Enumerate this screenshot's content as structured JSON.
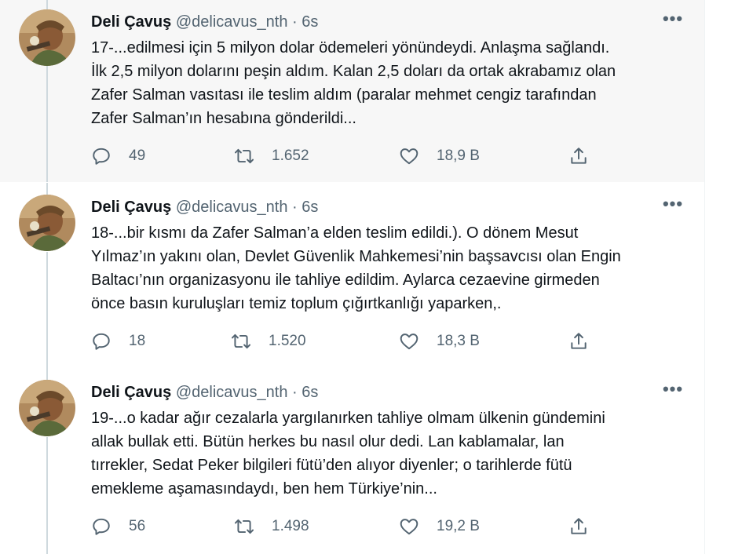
{
  "tweets": [
    {
      "name": "Deli Çavuş",
      "handle": "@delicavus_nth",
      "separator": "·",
      "time": "6s",
      "more": "•••",
      "lines": [
        "17-...edilmesi için 5 milyon dolar ödemeleri yönündeydi. Anlaşma sağlandı.",
        "İlk 2,5 milyon dolarını peşin aldım. Kalan 2,5 doları da ortak akrabamız olan",
        "Zafer Salman vasıtası ile teslim aldım (paralar mehmet cengiz tarafından",
        "Zafer Salman’ın hesabına gönderildi..."
      ],
      "replies": "49",
      "retweets": "1.652",
      "likes": "18,9 B"
    },
    {
      "name": "Deli Çavuş",
      "handle": "@delicavus_nth",
      "separator": "·",
      "time": "6s",
      "more": "•••",
      "lines": [
        "18-...bir kısmı da Zafer Salman’a elden teslim edildi.). O dönem Mesut",
        "Yılmaz’ın yakını olan, Devlet Güvenlik Mahkemesi’nin başsavcısı olan Engin",
        "Baltacı’nın organizasyonu ile tahliye edildim. Aylarca cezaevine girmeden",
        "önce basın kuruluşları temiz toplum çığırtkanlığı yaparken,."
      ],
      "replies": "18",
      "retweets": "1.520",
      "likes": "18,3 B"
    },
    {
      "name": "Deli Çavuş",
      "handle": "@delicavus_nth",
      "separator": "·",
      "time": "6s",
      "more": "•••",
      "lines": [
        "19-...o kadar ağır cezalarla yargılanırken tahliye olmam ülkenin gündemini",
        "allak bullak etti. Bütün herkes bu nasıl olur dedi. Lan kablamalar, lan",
        "tırrekler, Sedat Peker bilgileri fütü’den alıyor diyenler; o tarihlerde fütü",
        "emekleme aşamasındaydı, ben hem Türkiye’nin..."
      ],
      "replies": "56",
      "retweets": "1.498",
      "likes": "19,2 B"
    }
  ],
  "icons": {
    "reply": "reply-icon",
    "retweet": "retweet-icon",
    "like": "heart-icon",
    "share": "share-icon",
    "more": "more-icon"
  },
  "colors": {
    "text": "#0f1419",
    "muted": "#536471",
    "thread_line": "#cfd9de",
    "highlight_bg": "#f7f7f7"
  }
}
